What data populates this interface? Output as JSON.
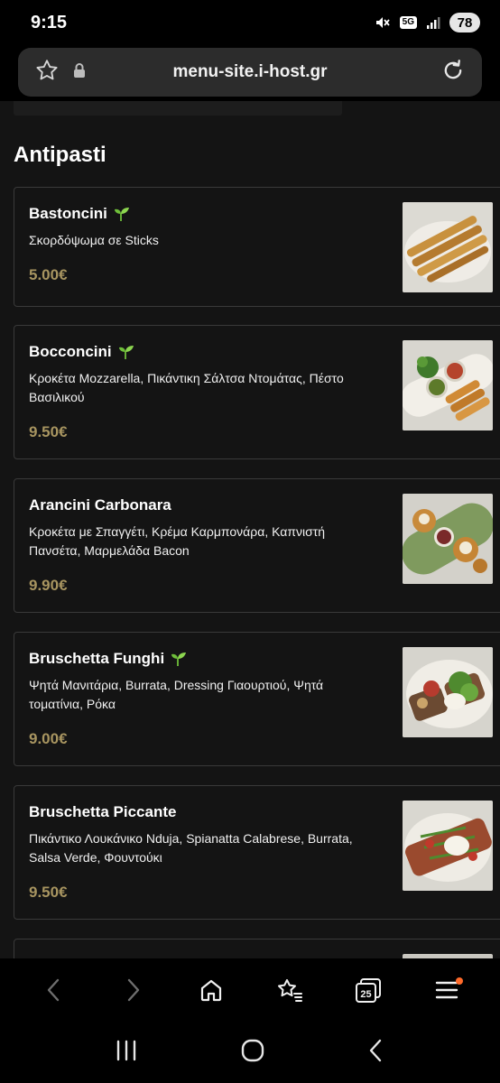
{
  "status_bar": {
    "time": "9:15",
    "network": "5G",
    "battery": "78",
    "icons": [
      "mute-icon",
      "5g-icon",
      "signal-icon",
      "battery-icon"
    ]
  },
  "browser": {
    "url": "menu-site.i-host.gr",
    "icons": [
      "star-icon",
      "lock-icon",
      "reload-icon"
    ],
    "bottom_bar": [
      "back-icon",
      "forward-icon",
      "home-icon",
      "bookmarks-icon",
      "tabs-icon",
      "menu-icon"
    ],
    "tabs_count": "25"
  },
  "menu": {
    "section_title": "Antipasti",
    "items": [
      {
        "name": "Bastoncini",
        "vegetarian": true,
        "description": "Σκορδόψωμα σε Sticks",
        "price": "5.00€"
      },
      {
        "name": "Bocconcini",
        "vegetarian": true,
        "description": "Κροκέτα Mozzarella, Πικάντικη Σάλτσα Ντομάτας, Πέστο Βασιλικού",
        "price": "9.50€"
      },
      {
        "name": "Arancini Carbonara",
        "vegetarian": false,
        "description": "Κροκέτα με Σπαγγέτι, Κρέμα Καρμπονάρα, Καπνιστή Πανσέτα, Μαρμελάδα Bacon",
        "price": "9.90€"
      },
      {
        "name": "Bruschetta Funghi",
        "vegetarian": true,
        "description": "Ψητά Μανιτάρια, Burrata, Dressing Γιαουρτιού, Ψητά τοματίνια, Ρόκα",
        "price": "9.00€"
      },
      {
        "name": "Bruschetta Piccante",
        "vegetarian": false,
        "description": "Πικάντικο Λουκάνικο Nduja, Spianatta Calabrese, Burrata, Salsa Verde, Φουντούκι",
        "price": "9.50€"
      }
    ]
  },
  "system_nav": [
    "recents-icon",
    "home-icon",
    "back-icon"
  ],
  "colors": {
    "background": "#141414",
    "card_border": "#3a3a3a",
    "price": "#a89560",
    "accent_dot": "#ff6a2a"
  }
}
